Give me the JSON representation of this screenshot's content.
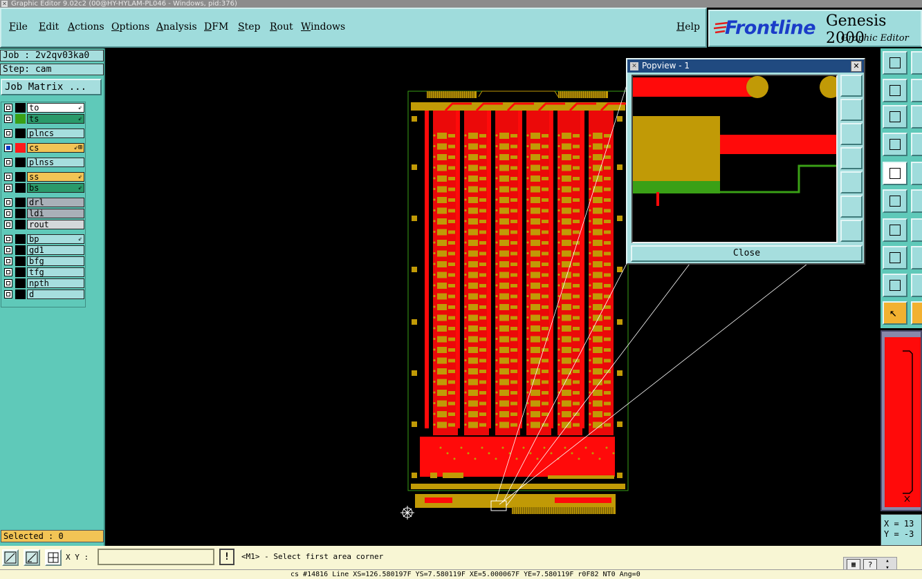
{
  "window": {
    "title": "Graphic Editor 9.02c2 (00@HY-HYLAM-PL046 - Windows, pid:376)"
  },
  "menu": [
    "File",
    "Edit",
    "Actions",
    "Options",
    "Analysis",
    "DFM",
    "Step",
    "Rout",
    "Windows"
  ],
  "help_label": "Help",
  "brand": {
    "logo": "Frontline",
    "product": "Genesis 2000",
    "subtitle": "Graphic Editor"
  },
  "job": {
    "job_label": "Job : 2v2qv03ka0",
    "step_label": "Step: cam",
    "matrix_button": "Job Matrix ..."
  },
  "layers": [
    {
      "name": "to",
      "color": "#ffffff",
      "swatch": "#000000",
      "flag": "⇙"
    },
    {
      "name": "ts",
      "color": "#2a9a6a",
      "swatch": "#3aa016",
      "flag": "⇙"
    },
    {
      "name": "plncs",
      "color": "#a6dede",
      "swatch": "#000000",
      "flag": ""
    },
    {
      "name": "cs",
      "color": "#f2c455",
      "swatch": "#ff1a1a",
      "flag": "⇙⊞",
      "active": true
    },
    {
      "name": "plnss",
      "color": "#a6dede",
      "swatch": "#000000",
      "flag": ""
    },
    {
      "name": "ss",
      "color": "#f2c455",
      "swatch": "#000000",
      "flag": "⇙"
    },
    {
      "name": "bs",
      "color": "#2a9a6a",
      "swatch": "#000000",
      "flag": "⇙"
    },
    {
      "name": "drl",
      "color": "#a9b0b8",
      "swatch": "#000000",
      "flag": ""
    },
    {
      "name": "ldi",
      "color": "#a9b0b8",
      "swatch": "#000000",
      "flag": ""
    },
    {
      "name": "rout",
      "color": "#d4d8da",
      "swatch": "#000000",
      "flag": ""
    },
    {
      "name": "bp",
      "color": "#a6dede",
      "swatch": "#000000",
      "flag": "⇙"
    },
    {
      "name": "gd1",
      "color": "#a6dede",
      "swatch": "#000000",
      "flag": ""
    },
    {
      "name": "bfg",
      "color": "#a6dede",
      "swatch": "#000000",
      "flag": ""
    },
    {
      "name": "tfg",
      "color": "#a6dede",
      "swatch": "#000000",
      "flag": ""
    },
    {
      "name": "npth",
      "color": "#a6dede",
      "swatch": "#000000",
      "flag": ""
    },
    {
      "name": "d",
      "color": "#a6dede",
      "swatch": "#000000",
      "flag": ""
    }
  ],
  "selected": "Selected : 0",
  "popview": {
    "title": "Popview - 1",
    "close_label": "Close"
  },
  "bottom": {
    "xy_label": "X Y :",
    "xy_value": "",
    "warn_label": "!",
    "prompt": "<M1> - Select first area corner"
  },
  "status": "cs #14816 Line XS=126.580197F YS=7.580119F XE=5.000067F YE=7.580119F r0F82 NT0 Ang=0",
  "coords": {
    "x": "X = 13",
    "y": "Y = -3"
  },
  "colors": {
    "panel": "#5fc9b9",
    "menubar": "#9fdcdc",
    "copper": "#ff0a0a",
    "pad": "#c19a06",
    "green": "#3aa016"
  }
}
